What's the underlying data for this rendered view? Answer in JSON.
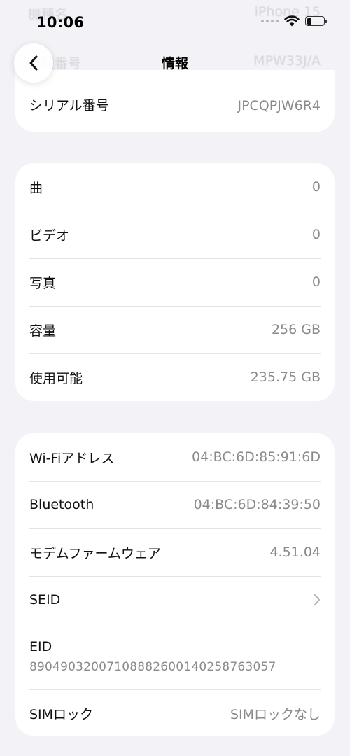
{
  "status_bar": {
    "time": "10:06"
  },
  "ghost_rows": [
    {
      "label": "機種名",
      "value": "iPhone 15"
    },
    {
      "label": "機種番号",
      "value": "MPW33J/A"
    }
  ],
  "nav": {
    "title": "情報"
  },
  "device_section": {
    "rows": [
      {
        "label": "シリアル番号",
        "value": "JPCQPJW6R4"
      }
    ]
  },
  "media_section": {
    "rows": [
      {
        "label": "曲",
        "value": "0"
      },
      {
        "label": "ビデオ",
        "value": "0"
      },
      {
        "label": "写真",
        "value": "0"
      },
      {
        "label": "容量",
        "value": "256 GB"
      },
      {
        "label": "使用可能",
        "value": "235.75 GB"
      }
    ]
  },
  "network_section": {
    "rows": [
      {
        "label": "Wi-Fiアドレス",
        "value": "04:BC:6D:85:91:6D"
      },
      {
        "label": "Bluetooth",
        "value": "04:BC:6D:84:39:50"
      },
      {
        "label": "モデムファームウェア",
        "value": "4.51.04"
      },
      {
        "label": "SEID",
        "icon": "chevron-right-icon"
      },
      {
        "label": "EID",
        "value": "89049032007108882600140258763057"
      },
      {
        "label": "SIMロック",
        "value": "SIMロックなし"
      }
    ]
  },
  "colors": {
    "background": "#f2f2f7",
    "card": "#ffffff",
    "secondary_text": "#8a8a8e",
    "separator": "#e3e3e6"
  }
}
